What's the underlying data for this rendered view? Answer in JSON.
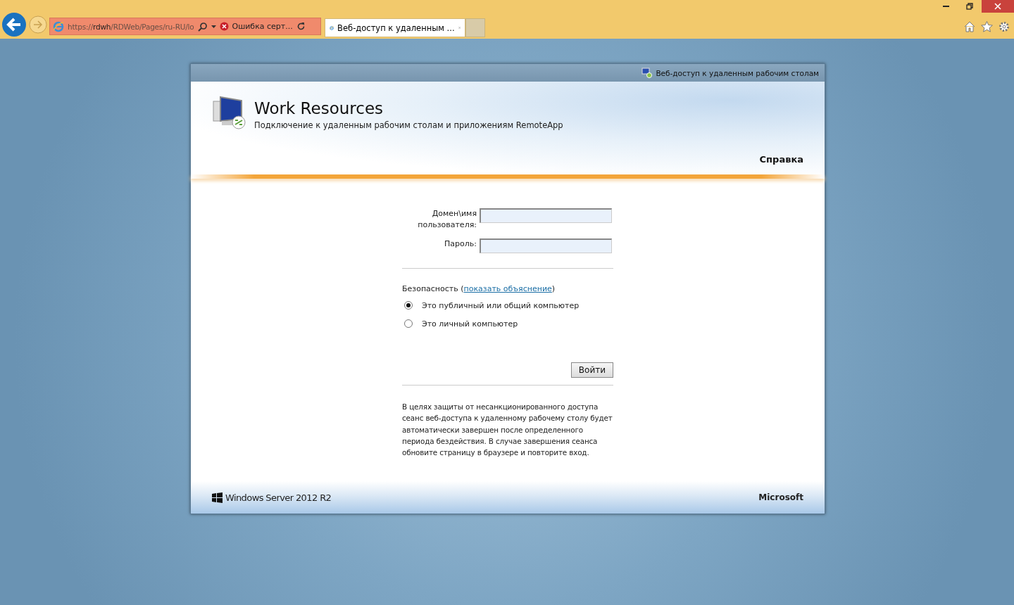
{
  "browser": {
    "address": {
      "url": "https://**rdwh**/RDWeb/Pages/ru-RU/lo",
      "certificate_error": "Ошибка серт..."
    },
    "tabs": [
      {
        "title": "Веб-доступ к удаленным ...",
        "selected": true
      }
    ]
  },
  "page": {
    "top_bar": {
      "title": "Веб-доступ к удаленным рабочим столам"
    },
    "header": {
      "title": "Work Resources",
      "subtitle": "Подключение к удаленным рабочим столам и приложениям RemoteApp",
      "help_link": "Справка"
    },
    "login_form": {
      "fields": [
        {
          "label": "Домен\\имя пользователя:"
        },
        {
          "label": "Пароль:"
        }
      ],
      "security": {
        "label": "Безопасность (",
        "link": "показать объяснение",
        "suffix": ")"
      },
      "options": [
        {
          "label": "Это публичный или общий компьютер",
          "selected": true
        },
        {
          "label": "Это личный компьютер",
          "selected": false
        }
      ],
      "submit": "Войти",
      "notice": "В целях защиты от несанкционированного доступа сеанс веб-доступа к удаленному рабочему столу будет автоматически завершен после определенного периода бездействия. В случае завершения сеанса обновите страницу в браузере и повторите вход."
    },
    "footer": {
      "product": "Windows Server 2012 R2",
      "vendor": "Microsoft"
    }
  }
}
